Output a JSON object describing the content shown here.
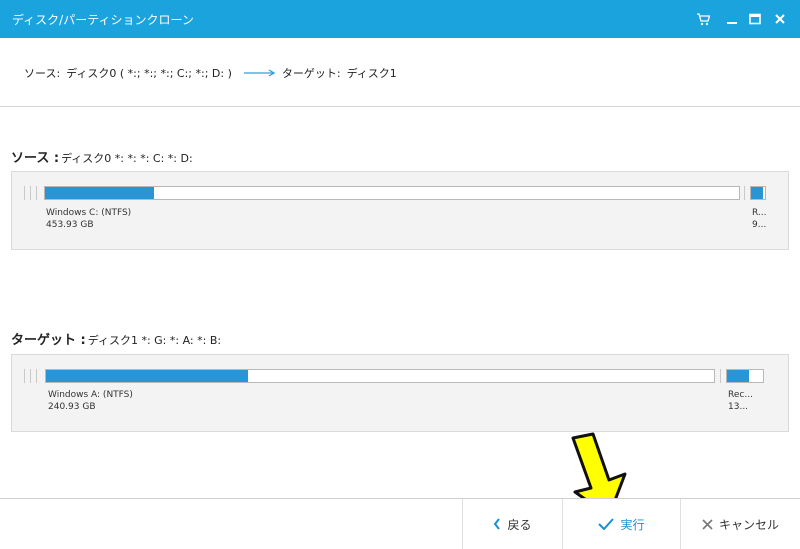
{
  "window": {
    "title": "ディスク/パーティションクローン",
    "controls": {
      "cart": "cart-icon",
      "minimize": "minimize-icon",
      "maximize": "maximize-icon",
      "close": "close-icon"
    }
  },
  "summary": {
    "source_label": "ソース:",
    "source_value": "ディスク0 ( *:; *:; *:; C:; *:; D: )",
    "target_label": "ターゲット:",
    "target_value": "ディスク1"
  },
  "source": {
    "heading": "ソース :",
    "disk": "ディスク0 *: *: *: C: *: D:",
    "partition": {
      "name": "Windows C: (NTFS)",
      "size": "453.93 GB",
      "used_fraction": 0.157
    },
    "small_partition": {
      "name": "R...",
      "size": "9..."
    }
  },
  "target": {
    "heading": "ターゲット :",
    "disk": "ディスク1 *: G: *: A: *: B:",
    "partition": {
      "name": "Windows A: (NTFS)",
      "size": "240.93 GB",
      "used_fraction": 0.302
    },
    "small_partition": {
      "name": "Rec...",
      "size": "13..."
    }
  },
  "footer": {
    "back_label": "戻る",
    "run_label": "実行",
    "cancel_label": "キャンセル"
  },
  "colors": {
    "accent": "#1aa3dd",
    "bar_fill": "#2896d6",
    "arrow_yellow": "#ffff00"
  }
}
